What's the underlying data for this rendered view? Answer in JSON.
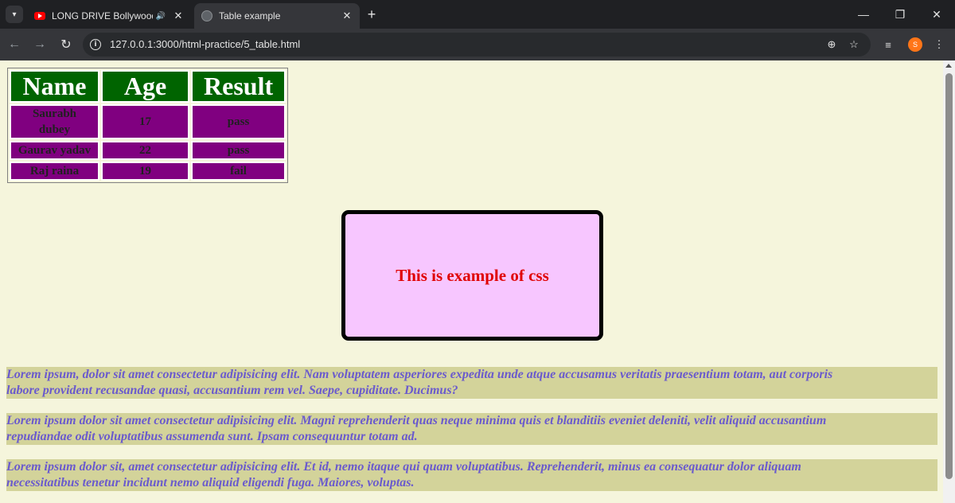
{
  "browser": {
    "tabs": [
      {
        "title": "LONG DRIVE Bollywood Mu",
        "active": false,
        "favicon": "youtube-icon",
        "playing_audio": true
      },
      {
        "title": "Table example",
        "active": true,
        "favicon": "globe-icon"
      }
    ],
    "url": "127.0.0.1:3000/html-practice/5_table.html",
    "profile_initial": "S",
    "icons": {
      "tab_dropdown": "▾",
      "close": "✕",
      "speaker": "🔊",
      "new_tab": "+",
      "minimize": "—",
      "restore": "❐",
      "window_close": "✕",
      "back": "←",
      "forward": "→",
      "reload": "↻",
      "info": "i",
      "zoom": "⊕",
      "bookmark": "☆",
      "media": "≡",
      "menu": "⋮"
    }
  },
  "page": {
    "table": {
      "headers": [
        "Name",
        "Age",
        "Result"
      ],
      "rows": [
        {
          "name_lines": [
            "Saurabh",
            "dubey"
          ],
          "age": "17",
          "result": "pass"
        },
        {
          "name_lines": [
            "Gaurav yadav"
          ],
          "age": "22",
          "result": "pass"
        },
        {
          "name_lines": [
            "Raj raina"
          ],
          "age": "19",
          "result": "fail"
        }
      ]
    },
    "css_box_text": "This is example of css",
    "paragraphs": [
      [
        "Lorem ipsum, dolor sit amet consectetur adipisicing elit. Nam voluptatem asperiores expedita unde atque accusamus veritatis praesentium totam, aut corporis",
        "labore provident recusandae quasi, accusantium rem vel. Saepe, cupiditate. Ducimus?"
      ],
      [
        "Lorem ipsum dolor sit amet consectetur adipisicing elit. Magni reprehenderit quas neque minima quis et blanditiis eveniet deleniti, velit aliquid accusantium",
        "repudiandae odit voluptatibus assumenda sunt. Ipsam consequuntur totam ad."
      ],
      [
        "Lorem ipsum dolor sit, amet consectetur adipisicing elit. Et id, nemo itaque qui quam voluptatibus. Reprehenderit, minus ea consequatur dolor aliquam",
        "necessitatibus tenetur incidunt nemo aliquid eligendi fuga. Maiores, voluptas."
      ]
    ]
  },
  "colors": {
    "page_bg": "#f5f5dc",
    "table_header_bg": "#006400",
    "table_cell_bg": "#800080",
    "box_bg": "#f7c6ff",
    "box_text": "#e00000",
    "para_bg": "#d3d39a",
    "para_text": "#6a5acd"
  }
}
